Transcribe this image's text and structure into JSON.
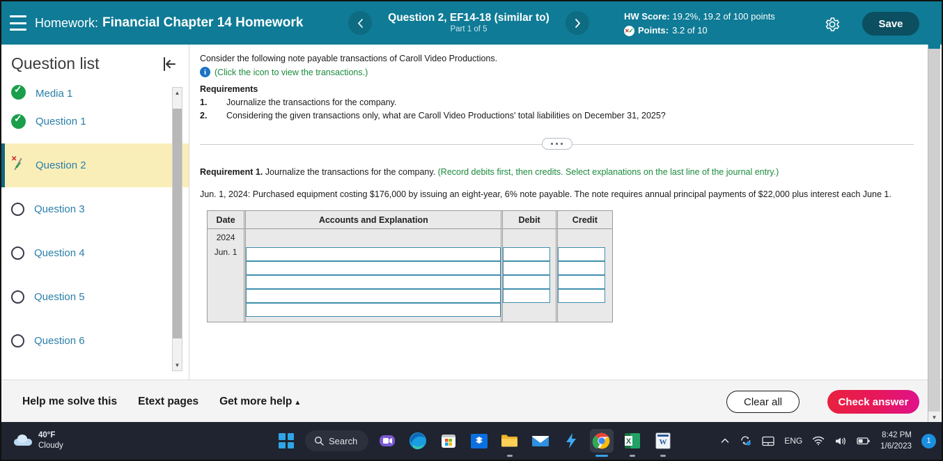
{
  "header": {
    "menu_icon": "hamburger-icon",
    "label": "Homework:",
    "title": "Financial Chapter 14 Homework",
    "prev_icon": "chevron-left-icon",
    "next_icon": "chevron-right-icon",
    "question_title": "Question 2, EF14-18 (similar to)",
    "part_text": "Part 1 of 5",
    "hw_score_label": "HW Score:",
    "hw_score_value": "19.2%, 19.2 of 100 points",
    "points_label": "Points:",
    "points_value": "3.2 of 10",
    "gear_icon": "gear-icon",
    "save_label": "Save",
    "bg_color": "#0f7b96",
    "save_bg_color": "#0b4f60"
  },
  "sidebar": {
    "title": "Question list",
    "collapse_icon": "collapse-panel-icon",
    "items": [
      {
        "label": "Media 1",
        "status": "done"
      },
      {
        "label": "Question 1",
        "status": "done"
      },
      {
        "label": "Question 2",
        "status": "partial"
      },
      {
        "label": "Question 3",
        "status": "empty"
      },
      {
        "label": "Question 4",
        "status": "empty"
      },
      {
        "label": "Question 5",
        "status": "empty"
      },
      {
        "label": "Question 6",
        "status": "empty"
      }
    ],
    "active_index": 2,
    "active_bg_color": "#faeeb8",
    "link_color": "#2a7fa8"
  },
  "content": {
    "intro": "Consider the following note payable transactions of Caroll Video Productions.",
    "info_icon": "info-icon",
    "info_link": "(Click the icon to view the transactions.)",
    "requirements_heading": "Requirements",
    "requirements": [
      {
        "num": "1.",
        "text": "Journalize the transactions for the company."
      },
      {
        "num": "2.",
        "text": "Considering the given transactions only, what are Caroll Video Productions' total liabilities on December 31, 2025?"
      }
    ],
    "expander_icon": "ellipsis-expander",
    "req1_label": "Requirement 1.",
    "req1_text": "Journalize the transactions for the company.",
    "req1_hint": "(Record debits first, then credits. Select explanations on the last line of the journal entry.)",
    "transaction_text": "Jun. 1, 2024: Purchased equipment costing $176,000 by issuing an eight-year, 6% note payable. The note requires annual principal payments of $22,000 plus interest each June 1."
  },
  "journal": {
    "columns": [
      "Date",
      "Accounts and Explanation",
      "Debit",
      "Credit"
    ],
    "date_year": "2024",
    "date_day": "Jun. 1",
    "rows": [
      {
        "account": "",
        "debit": "",
        "credit": "",
        "has_amounts": true
      },
      {
        "account": "",
        "debit": "",
        "credit": "",
        "has_amounts": true
      },
      {
        "account": "",
        "debit": "",
        "credit": "",
        "has_amounts": true
      },
      {
        "account": "",
        "debit": "",
        "credit": "",
        "has_amounts": true
      },
      {
        "account": "",
        "debit": "",
        "credit": "",
        "has_amounts": false
      }
    ],
    "field_border_color": "#3f8fad"
  },
  "bottombar": {
    "help_solve": "Help me solve this",
    "etext_pages": "Etext pages",
    "get_more_help": "Get more help",
    "get_more_help_caret": "▲",
    "clear_all": "Clear all",
    "check_answer": "Check answer",
    "check_answer_color": "#e7175b"
  },
  "taskbar": {
    "weather_temp": "40°F",
    "weather_cond": "Cloudy",
    "search_label": "Search",
    "start_icon": "windows-start-icon",
    "icons": [
      "teams-chat-icon",
      "edge-browser-icon",
      "microsoft-store-icon",
      "dropbox-icon",
      "file-explorer-icon",
      "mail-icon",
      "lightning-icon",
      "chrome-browser-icon",
      "excel-icon",
      "word-icon"
    ],
    "tray_chevron": "show-hidden-icons-icon",
    "tray_language": "ENG",
    "tray_time": "8:42 PM",
    "tray_date": "1/6/2023",
    "notification_count": "1"
  }
}
